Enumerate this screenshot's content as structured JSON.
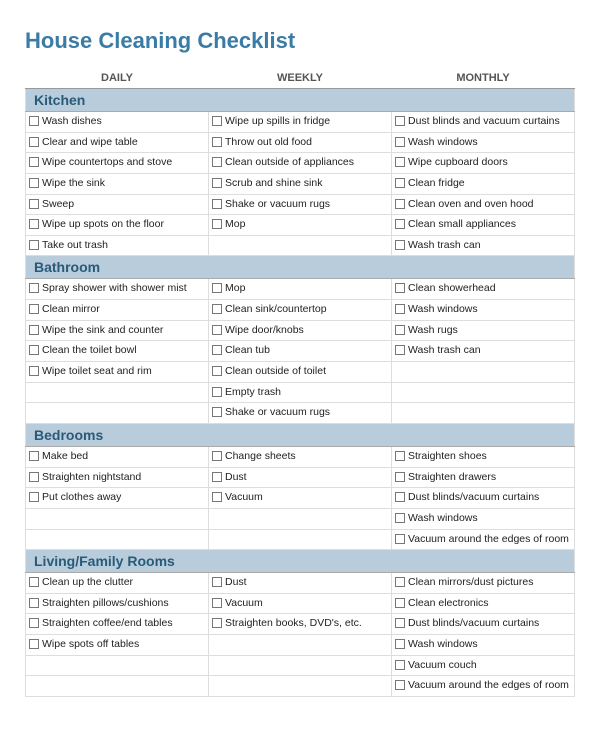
{
  "title": "House Cleaning Checklist",
  "columns": [
    "DAILY",
    "WEEKLY",
    "MONTHLY"
  ],
  "sections": [
    {
      "name": "Kitchen",
      "daily": [
        "Wash dishes",
        "Clear and wipe table",
        "Wipe countertops and stove",
        "Wipe the sink",
        "Sweep",
        "Wipe up spots on the floor",
        "Take out trash"
      ],
      "weekly": [
        "Wipe up spills in fridge",
        "Throw out old food",
        "Clean outside of appliances",
        "Scrub and shine sink",
        "Shake or vacuum rugs",
        "Mop"
      ],
      "monthly": [
        "Dust blinds and vacuum curtains",
        "Wash windows",
        "Wipe cupboard doors",
        "Clean fridge",
        "Clean oven and oven hood",
        "Clean small appliances",
        "Wash trash can"
      ]
    },
    {
      "name": "Bathroom",
      "daily": [
        "Spray shower with shower mist",
        "Clean mirror",
        "Wipe the sink and counter",
        "Clean the toilet bowl",
        "Wipe toilet seat and rim",
        "",
        ""
      ],
      "weekly": [
        "Mop",
        "Clean sink/countertop",
        "Wipe door/knobs",
        "Clean tub",
        "Clean outside of toilet",
        "Empty trash",
        "Shake or vacuum rugs"
      ],
      "monthly": [
        "Clean showerhead",
        "Wash windows",
        "Wash rugs",
        "Wash trash can",
        "",
        "",
        ""
      ]
    },
    {
      "name": "Bedrooms",
      "daily": [
        "Make bed",
        "Straighten nightstand",
        "Put clothes away",
        "",
        ""
      ],
      "weekly": [
        "Change sheets",
        "Dust",
        "Vacuum",
        "",
        ""
      ],
      "monthly": [
        "Straighten shoes",
        "Straighten drawers",
        "Dust blinds/vacuum curtains",
        "Wash windows",
        "Vacuum around the edges of room"
      ]
    },
    {
      "name": "Living/Family Rooms",
      "daily": [
        "Clean up the clutter",
        "Straighten pillows/cushions",
        "Straighten coffee/end tables",
        "Wipe spots off tables",
        ""
      ],
      "weekly": [
        "Dust",
        "Vacuum",
        "Straighten books, DVD's, etc.",
        "",
        ""
      ],
      "monthly": [
        "Clean mirrors/dust pictures",
        "Clean electronics",
        "Dust blinds/vacuum curtains",
        "Wash windows",
        "Vacuum couch",
        "Vacuum around the edges of room"
      ]
    }
  ]
}
